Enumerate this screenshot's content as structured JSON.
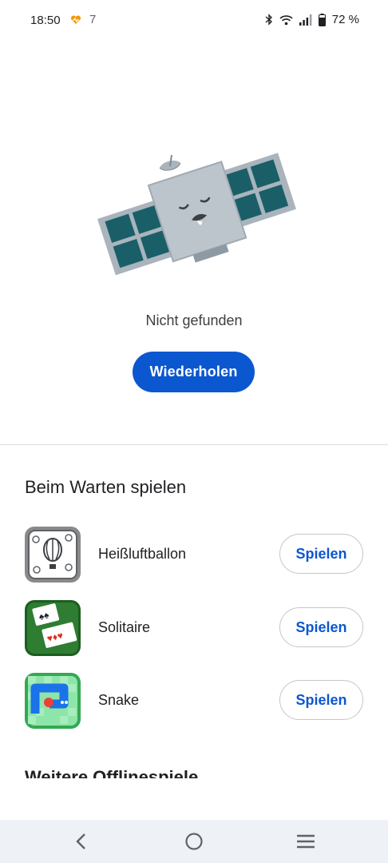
{
  "status_bar": {
    "time": "18:50",
    "notification_extra": "7",
    "battery_text": "72 %",
    "icons": [
      "health-heart-icon",
      "bluetooth-icon",
      "wifi-icon",
      "signal-icon",
      "battery-icon"
    ]
  },
  "hero": {
    "illustration": "sleeping-satellite-illustration",
    "message": "Nicht gefunden",
    "retry_label": "Wiederholen"
  },
  "games_section": {
    "title": "Beim Warten spielen",
    "games": [
      {
        "name": "Heißluftballon",
        "icon": "hot-air-balloon-game-icon",
        "play_label": "Spielen"
      },
      {
        "name": "Solitaire",
        "icon": "solitaire-game-icon",
        "play_label": "Spielen"
      },
      {
        "name": "Snake",
        "icon": "snake-game-icon",
        "play_label": "Spielen"
      }
    ]
  },
  "more_section": {
    "title": "Weitere Offlinespiele"
  },
  "nav_bar": {
    "icons": [
      "back-icon",
      "home-icon",
      "recents-icon"
    ]
  },
  "colors": {
    "primary": "#0b57d0",
    "satellite_panel": "#1a5f68",
    "satellite_body": "#a9b4bd"
  }
}
